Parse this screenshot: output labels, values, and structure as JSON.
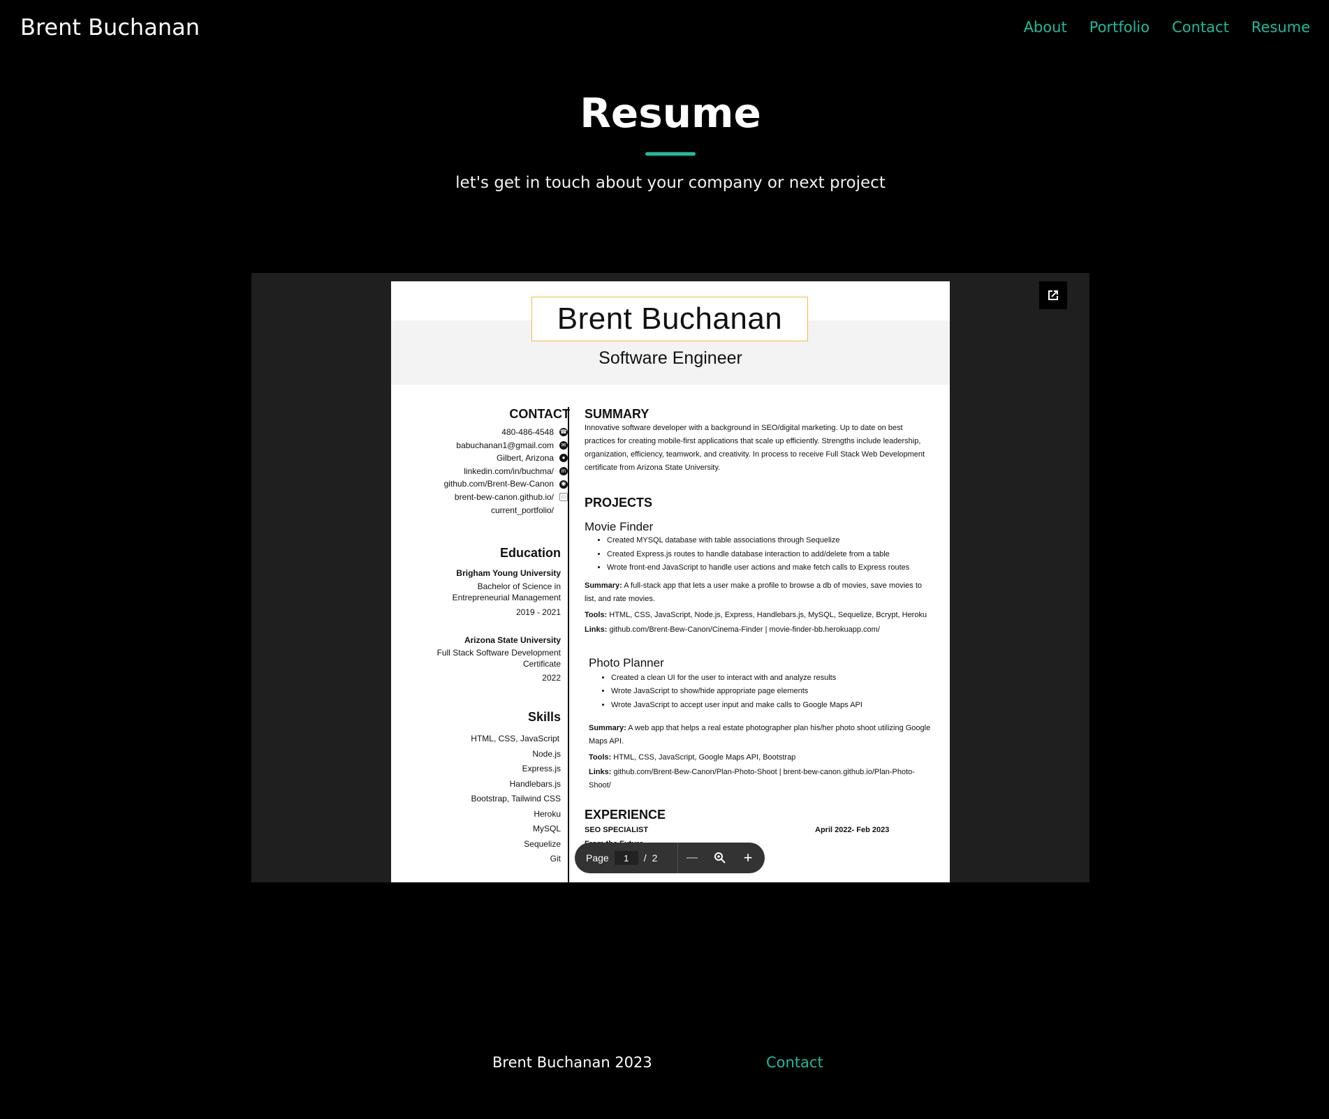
{
  "header": {
    "brand": "Brent Buchanan",
    "nav": [
      "About",
      "Portfolio",
      "Contact",
      "Resume"
    ]
  },
  "hero": {
    "title": "Resume",
    "subtitle": "let's get in touch about your company or next project"
  },
  "colors": {
    "accent": "#1abc9c",
    "background": "#000000",
    "viewer_bg": "#1f1f1f",
    "name_border": "#f4b942"
  },
  "resume": {
    "name": "Brent Buchanan",
    "role": "Software Engineer",
    "contact_heading": "CONTACT",
    "contact": [
      {
        "text": "480-486-4548",
        "icon": "phone-icon"
      },
      {
        "text": "babuchanan1@gmail.com",
        "icon": "email-icon"
      },
      {
        "text": "Gilbert, Arizona",
        "icon": "location-icon"
      },
      {
        "text": "linkedin.com/in/buchma/",
        "icon": "linkedin-icon"
      },
      {
        "text": "github.com/Brent-Bew-Canon",
        "icon": "github-icon"
      },
      {
        "text": "brent-bew-canon.github.io/",
        "icon": "briefcase-icon"
      },
      {
        "text": "current_portfolio/",
        "icon": ""
      }
    ],
    "education_heading": "Education",
    "education": [
      {
        "school": "Brigham Young University",
        "degree_1": "Bachelor of Science in",
        "degree_2": "Entrepreneurial Management",
        "years": "2019 - 2021"
      },
      {
        "school": "Arizona State University",
        "degree_1": "Full Stack Software Development",
        "degree_2": "Certificate",
        "years": "2022"
      }
    ],
    "skills_heading": "Skills",
    "skills": [
      "HTML, CSS, JavaScript",
      "Node.js",
      "Express.js",
      "Handlebars.js",
      "Bootstrap, Tailwind CSS",
      "Heroku",
      "MySQL",
      "Sequelize",
      "Git"
    ],
    "summary_heading": "SUMMARY",
    "summary": "Innovative software developer with a background in SEO/digital marketing. Up to date on best practices for creating mobile-first applications that scale up efficiently. Strengths include leadership, organization, efficiency, teamwork, and creativity. In process to receive Full Stack Web Development certificate from Arizona State University.",
    "projects_heading": "PROJECTS",
    "projects": [
      {
        "title": "Movie Finder",
        "bullets": [
          "Created MYSQL database with table associations through Sequelize",
          "Created Express.js routes to handle database interaction to add/delete from a table",
          "Wrote front-end JavaScript to handle user actions and make fetch calls to Express routes"
        ],
        "summary_label": "Summary:",
        "summary": "A full-stack app that lets a user make a profile to browse a db of movies, save movies to list, and rate movies.",
        "tools_label": "Tools:",
        "tools": "HTML, CSS, JavaScript, Node.js, Express, Handlebars.js, MySQL, Sequelize, Bcrypt, Heroku",
        "links_label": "Links:",
        "links": "github.com/Brent-Bew-Canon/Cinema-Finder  |  movie-finder-bb.herokuapp.com/"
      },
      {
        "title": "Photo Planner",
        "bullets": [
          "Created a clean UI for the user to interact with and analyze results",
          "Wrote JavaScript to show/hide appropriate page elements",
          "Wrote JavaScript to accept user input and make calls to Google Maps API"
        ],
        "summary_label": "Summary:",
        "summary": "A web app that helps a real estate photographer plan his/her photo shoot utilizing Google Maps API.",
        "tools_label": "Tools:",
        "tools": "HTML, CSS, JavaScript, Google Maps API, Bootstrap",
        "links_label": "Links:",
        "links": "github.com/Brent-Bew-Canon/Plan-Photo-Shoot  |  brent-bew-canon.github.io/Plan-Photo-Shoot/"
      }
    ],
    "experience_heading": "EXPERIENCE",
    "experience_role": "SEO SPECIALIST",
    "experience_dates": "April 2022- Feb 2023",
    "experience_company": "From the Future"
  },
  "pdf_toolbar": {
    "page_label": "Page",
    "current_page": "1",
    "separator": "/",
    "total_pages": "2",
    "zoom_out": "—",
    "zoom_in": "+"
  },
  "footer": {
    "copyright": "Brent Buchanan 2023",
    "contact": "Contact"
  }
}
